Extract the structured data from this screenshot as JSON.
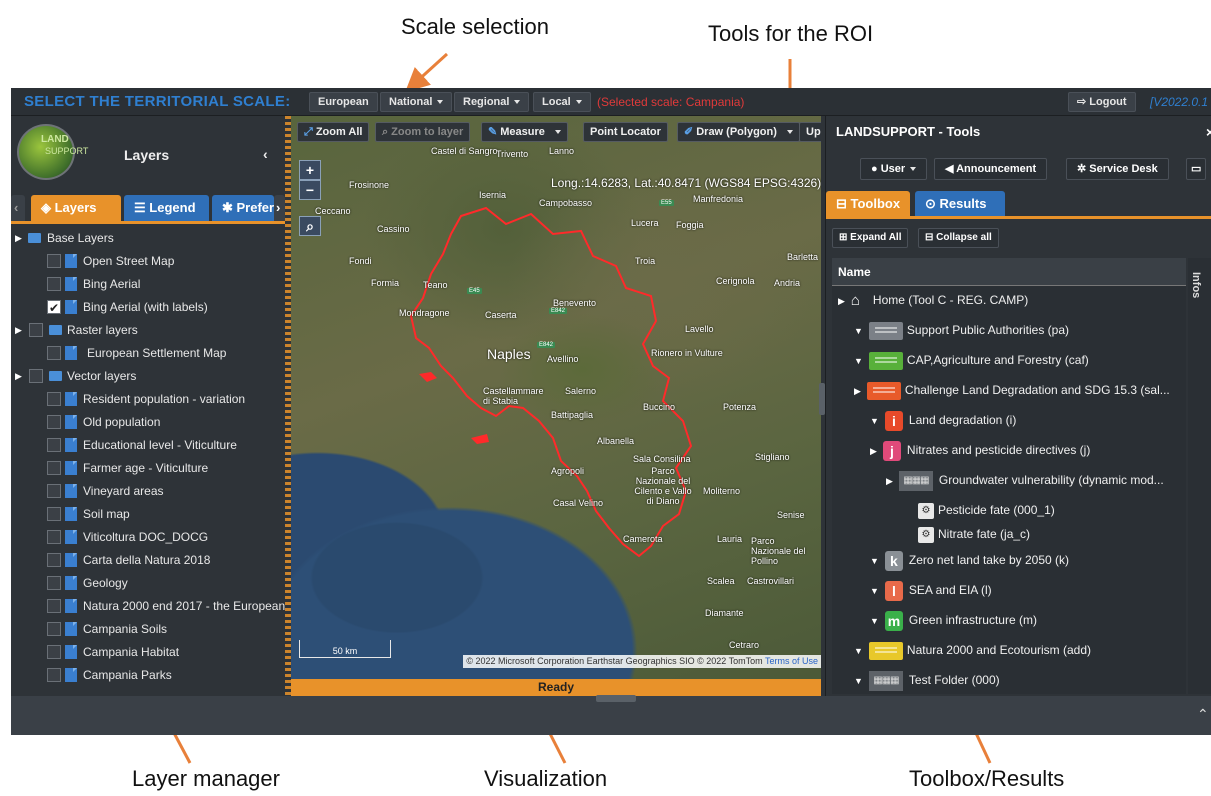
{
  "annotations": {
    "scale_selection": "Scale selection",
    "tools_roi": "Tools for the ROI",
    "layer_manager": "Layer manager",
    "visualization": "Visualization",
    "toolbox_results": "Toolbox/Results"
  },
  "topbar": {
    "title": "SELECT THE TERRITORIAL SCALE:",
    "scales": [
      "European",
      "National",
      "Regional",
      "Local"
    ],
    "selected_scale": "(Selected scale: Campania)",
    "logout": "Logout",
    "version": "[V2022.0.1"
  },
  "left": {
    "logo_text": "LAND",
    "logo_sub": "SUPPORT",
    "title": "Layers",
    "tabs": [
      "Layers",
      "Legend",
      "Prefer"
    ],
    "tree": [
      {
        "label": "Base Layers",
        "type": "folder"
      },
      {
        "label": "Open Street Map",
        "type": "layer",
        "checked": false
      },
      {
        "label": "Bing Aerial",
        "type": "layer",
        "checked": false
      },
      {
        "label": "Bing Aerial (with labels)",
        "type": "layer",
        "checked": true
      },
      {
        "label": "Raster layers",
        "type": "folder"
      },
      {
        "label": "European Settlement Map",
        "type": "layer",
        "checked": false
      },
      {
        "label": "Vector layers",
        "type": "folder"
      },
      {
        "label": "Resident population - variation",
        "type": "layer",
        "checked": false
      },
      {
        "label": "Old population",
        "type": "layer",
        "checked": false
      },
      {
        "label": "Educational level - Viticulture",
        "type": "layer",
        "checked": false
      },
      {
        "label": "Farmer age - Viticulture",
        "type": "layer",
        "checked": false
      },
      {
        "label": "Vineyard areas",
        "type": "layer",
        "checked": false
      },
      {
        "label": "Soil map",
        "type": "layer",
        "checked": false
      },
      {
        "label": "Viticoltura DOC_DOCG",
        "type": "layer",
        "checked": false
      },
      {
        "label": "Carta della Natura 2018",
        "type": "layer",
        "checked": false
      },
      {
        "label": "Geology",
        "type": "layer",
        "checked": false
      },
      {
        "label": "Natura 2000 end 2017 - the European",
        "type": "layer",
        "checked": false
      },
      {
        "label": "Campania Soils",
        "type": "layer",
        "checked": false
      },
      {
        "label": "Campania Habitat",
        "type": "layer",
        "checked": false
      },
      {
        "label": "Campania Parks",
        "type": "layer",
        "checked": false
      }
    ]
  },
  "map": {
    "toolbar": [
      "Zoom All",
      "Zoom to layer",
      "Measure",
      "Point Locator",
      "Draw (Polygon)",
      "Upl"
    ],
    "coords": "Long.:14.6283, Lat.:40.8471 (WGS84 EPSG:4326)",
    "places": [
      "Castel di Sangro",
      "Trivento",
      "Lanno",
      "Frosinone",
      "Isernia",
      "Campobasso",
      "Manfredonia",
      "Ceccano",
      "Cassino",
      "Lucera",
      "Foggia",
      "Barletta",
      "Fondi",
      "Troia",
      "Cerignola",
      "Andria",
      "Formia",
      "Teano",
      "Benevento",
      "Mondragone",
      "Caserta",
      "Lavello",
      "Naples",
      "Avellino",
      "Rionero in Vulture",
      "Castellammare di Stabia",
      "Salerno",
      "Potenza",
      "Battipaglia",
      "Buccino",
      "Albanella",
      "Sala Consilina",
      "Stigliano",
      "Agropoli",
      "Parco Nazionale del Cilento e Vallo di Diano",
      "Moliterno",
      "Casal Velino",
      "Senise",
      "Camerota",
      "Lauria",
      "Parco Nazionale del Pollino",
      "Scalea",
      "Castrovillari",
      "Diamante",
      "Cetraro"
    ],
    "scale_label": "50 km",
    "attribution": "© 2022 Microsoft Corporation Earthstar Geographics SIO © 2022 TomTom",
    "attribution_link": "Terms of Use",
    "status": "Ready"
  },
  "right": {
    "title": "LANDSUPPORT - Tools",
    "buttons": [
      "User",
      "Announcement",
      "Service Desk"
    ],
    "tabs": [
      "Toolbox",
      "Results"
    ],
    "expand_all": "Expand All",
    "collapse_all": "Collapse all",
    "column": "Name",
    "infos": "Infos",
    "tree": [
      {
        "label": "Home (Tool C - REG. CAMP)"
      },
      {
        "label": "Support Public Authorities (pa)"
      },
      {
        "label": "CAP,Agriculture and Forestry (caf)"
      },
      {
        "label": "Challenge Land Degradation and SDG 15.3 (sal..."
      },
      {
        "label": "Land degradation (i)",
        "letter": "i"
      },
      {
        "label": "Nitrates and pesticide directives (j)",
        "letter": "j"
      },
      {
        "label": "Groundwater vulnerability (dynamic mod..."
      },
      {
        "label": "Pesticide fate (000_1)"
      },
      {
        "label": "Nitrate fate (ja_c)"
      },
      {
        "label": "Zero net land take by 2050 (k)",
        "letter": "k"
      },
      {
        "label": "SEA and EIA (l)",
        "letter": "l"
      },
      {
        "label": "Green infrastructure (m)",
        "letter": "m"
      },
      {
        "label": "Natura 2000 and Ecotourism (add)"
      },
      {
        "label": "Test Folder (000)"
      }
    ]
  },
  "colors": {
    "accent_orange": "#e8922a",
    "title_blue": "#2f7fd0",
    "selected_red": "#e03a3a",
    "boundary_red": "#ff2a2a"
  }
}
